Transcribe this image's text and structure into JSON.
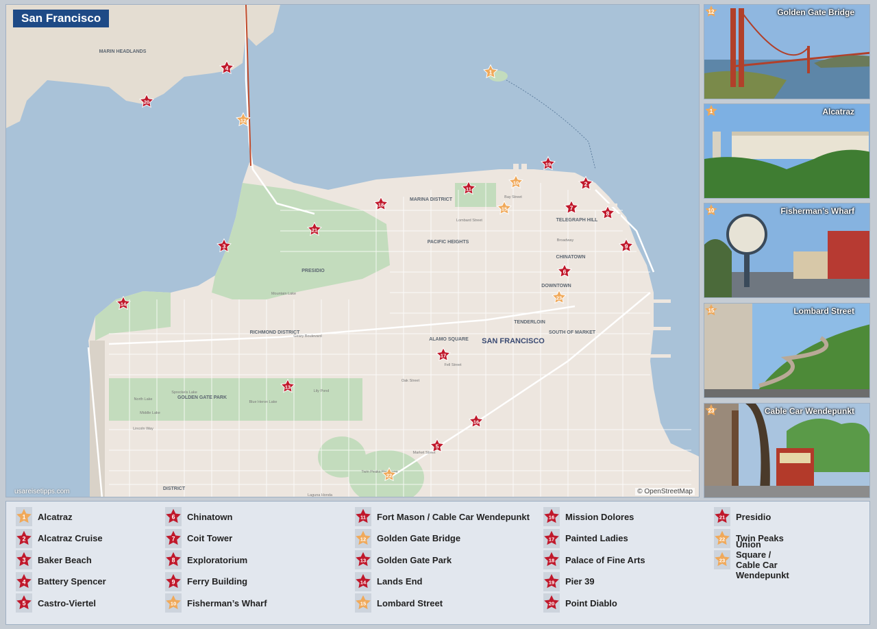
{
  "map": {
    "title": "San Francisco",
    "credit_left": "usareisetipps.com",
    "credit_right": "© OpenStreetMap",
    "city_label": "SAN FRANCISCO",
    "areas": [
      "MARIN HEADLANDS",
      "MARINA DISTRICT",
      "TELEGRAPH HILL",
      "PACIFIC HEIGHTS",
      "CHINATOWN",
      "PRESIDIO",
      "DOWNTOWN",
      "TENDERLOIN",
      "RICHMOND DISTRICT",
      "ALAMO SQUARE",
      "SOUTH OF MARKET",
      "GOLDEN GATE PARK",
      "DISTRICT"
    ],
    "streets": [
      "Geary Boulevard",
      "Lombard Street",
      "Bay Street",
      "Fell Street",
      "Oak Street",
      "Lincoln Way",
      "Market Street",
      "Broadway",
      "Mountain Lake",
      "Spreckels Lake",
      "Lily Pond",
      "Blue Heron Lake",
      "Middle Lake",
      "North Lake",
      "Twin Peaks Reservoir",
      "Laguna Honda"
    ],
    "markers": [
      {
        "n": "1",
        "type": "orange"
      },
      {
        "n": "2",
        "type": "red"
      },
      {
        "n": "3",
        "type": "red"
      },
      {
        "n": "4",
        "type": "red"
      },
      {
        "n": "5",
        "type": "red"
      },
      {
        "n": "6",
        "type": "red"
      },
      {
        "n": "7",
        "type": "red"
      },
      {
        "n": "8",
        "type": "red"
      },
      {
        "n": "9",
        "type": "red"
      },
      {
        "n": "10",
        "type": "orange"
      },
      {
        "n": "11",
        "type": "red"
      },
      {
        "n": "12",
        "type": "orange"
      },
      {
        "n": "13",
        "type": "red"
      },
      {
        "n": "14",
        "type": "red"
      },
      {
        "n": "15",
        "type": "orange"
      },
      {
        "n": "16",
        "type": "red"
      },
      {
        "n": "17",
        "type": "red"
      },
      {
        "n": "18",
        "type": "red"
      },
      {
        "n": "19",
        "type": "red"
      },
      {
        "n": "20",
        "type": "red"
      },
      {
        "n": "21",
        "type": "red"
      },
      {
        "n": "22",
        "type": "orange"
      },
      {
        "n": "23",
        "type": "orange"
      }
    ]
  },
  "photos": [
    {
      "caption": "Golden Gate Bridge",
      "num": "12"
    },
    {
      "caption": "Alcatraz",
      "num": "1"
    },
    {
      "caption": "Fisherman’s Wharf",
      "num": "10"
    },
    {
      "caption": "Lombard Street",
      "num": "15"
    },
    {
      "caption": "Cable Car Wendepunkt",
      "num": "23"
    }
  ],
  "legend": [
    {
      "n": "1",
      "label": "Alcatraz",
      "type": "orange"
    },
    {
      "n": "2",
      "label": "Alcatraz Cruise",
      "type": "red"
    },
    {
      "n": "3",
      "label": "Baker Beach",
      "type": "red"
    },
    {
      "n": "4",
      "label": "Battery Spencer",
      "type": "red"
    },
    {
      "n": "5",
      "label": "Castro-Viertel",
      "type": "red"
    },
    {
      "n": "6",
      "label": "Chinatown",
      "type": "red"
    },
    {
      "n": "7",
      "label": "Coit Tower",
      "type": "red"
    },
    {
      "n": "8",
      "label": "Exploratorium",
      "type": "red"
    },
    {
      "n": "9",
      "label": "Ferry Building",
      "type": "red"
    },
    {
      "n": "10",
      "label": "Fisherman’s Wharf",
      "type": "orange"
    },
    {
      "n": "11",
      "label": "Fort Mason / Cable Car Wendepunkt",
      "type": "red"
    },
    {
      "n": "12",
      "label": "Golden Gate Bridge",
      "type": "orange"
    },
    {
      "n": "13",
      "label": "Golden Gate Park",
      "type": "red"
    },
    {
      "n": "14",
      "label": "Lands End",
      "type": "red"
    },
    {
      "n": "15",
      "label": "Lombard Street",
      "type": "orange"
    },
    {
      "n": "16",
      "label": "Mission Dolores",
      "type": "red"
    },
    {
      "n": "17",
      "label": "Painted Ladies",
      "type": "red"
    },
    {
      "n": "18",
      "label": "Palace of Fine Arts",
      "type": "red"
    },
    {
      "n": "19",
      "label": "Pier 39",
      "type": "red"
    },
    {
      "n": "20",
      "label": "Point Diablo",
      "type": "red"
    },
    {
      "n": "21",
      "label": "Presidio",
      "type": "red"
    },
    {
      "n": "22",
      "label": "Twin Peaks",
      "type": "orange"
    },
    {
      "n": "23",
      "label": "Union Square / Cable Car Wendepunkt",
      "type": "orange"
    }
  ],
  "colors": {
    "red": "#c0182b",
    "orange": "#f0a95a",
    "water": "#a9c2d8",
    "land": "#ede6df",
    "park": "#c3dcbd",
    "title_bg": "#1e4a86"
  }
}
